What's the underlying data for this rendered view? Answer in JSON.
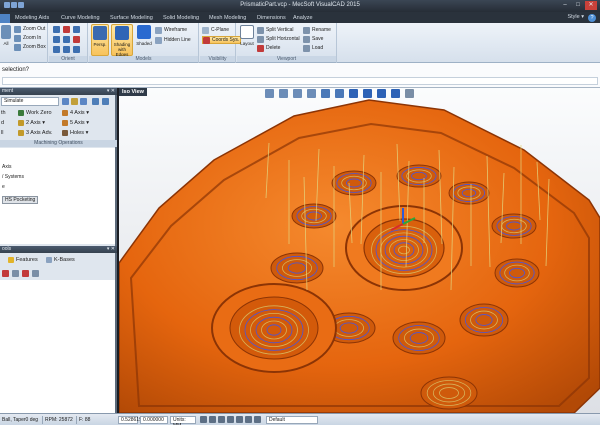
{
  "window": {
    "title": "PrismaticPart.vcp - MecSoft VisualCAD 2015",
    "controls": [
      "–",
      "□",
      "✕"
    ]
  },
  "tabs": [
    {
      "label": "Modeling Aids"
    },
    {
      "label": "Curve Modeling"
    },
    {
      "label": "Surface Modeling"
    },
    {
      "label": "Solid Modeling"
    },
    {
      "label": "Mesh Modeling"
    },
    {
      "label": "Dimensions"
    },
    {
      "label": "Analyze"
    }
  ],
  "style_label": "Style ▾",
  "help_label": "?",
  "ribbon": {
    "zoom_group": {
      "big_label": "All",
      "items": [
        "Zoom Out",
        "Zoom In",
        "Zoom Box"
      ]
    },
    "orient_group_label": "Orient",
    "models_group": {
      "label": "Models",
      "items": [
        "Persp.",
        "Shading with Edges",
        "Shaded",
        "Wireframe",
        "Hidden Line"
      ]
    },
    "visibility_group": {
      "label": "Visibility",
      "items": [
        "C-Plane",
        "Coords Sys."
      ]
    },
    "viewport_group": {
      "label": "Viewport",
      "big_label": "Layout",
      "items": [
        "Split Vertical",
        "Split Horizontal",
        "Delete",
        "Rename",
        "Save",
        "Load"
      ]
    }
  },
  "command": {
    "prompt": "selection?"
  },
  "left": {
    "panel1_title": "ment",
    "dropdown_value": "Simulate",
    "ops_label": "Machining Operations",
    "ops": [
      {
        "label": "Work Zero"
      },
      {
        "label": "4 Axis ▾"
      },
      {
        "label": "2 Axis ▾"
      },
      {
        "label": "5 Axis ▾"
      },
      {
        "label": "3 Axis Adv."
      },
      {
        "label": "Holes ▾"
      }
    ],
    "ops_left": [
      "th",
      "d",
      "ll"
    ],
    "tree": [
      {
        "label": "Axis"
      },
      {
        "label": "/ Systems"
      },
      {
        "label": "e"
      },
      {
        "label": "HS Pocketing"
      }
    ],
    "panel2_title": "ools",
    "panel2_items": [
      {
        "label": "Features"
      },
      {
        "label": "K-Bases"
      }
    ]
  },
  "viewport": {
    "view_label": "Iso View"
  },
  "status": {
    "cells": [
      "Ball, Taper0 deg",
      "RPM: 25872",
      "F: 88"
    ],
    "left_value": "0.528619",
    "mid_value": "0.000000",
    "units": "Units: MM",
    "layer_value": "Default"
  },
  "colors": {
    "part": "#e5650e",
    "part_shadow": "#8c3405",
    "toolpath_ring": "#d7b25a",
    "toolpath_blue": "#4a55d9",
    "rapid_line": "#e4d27a",
    "ribbon_sel": "#f7c35c"
  }
}
